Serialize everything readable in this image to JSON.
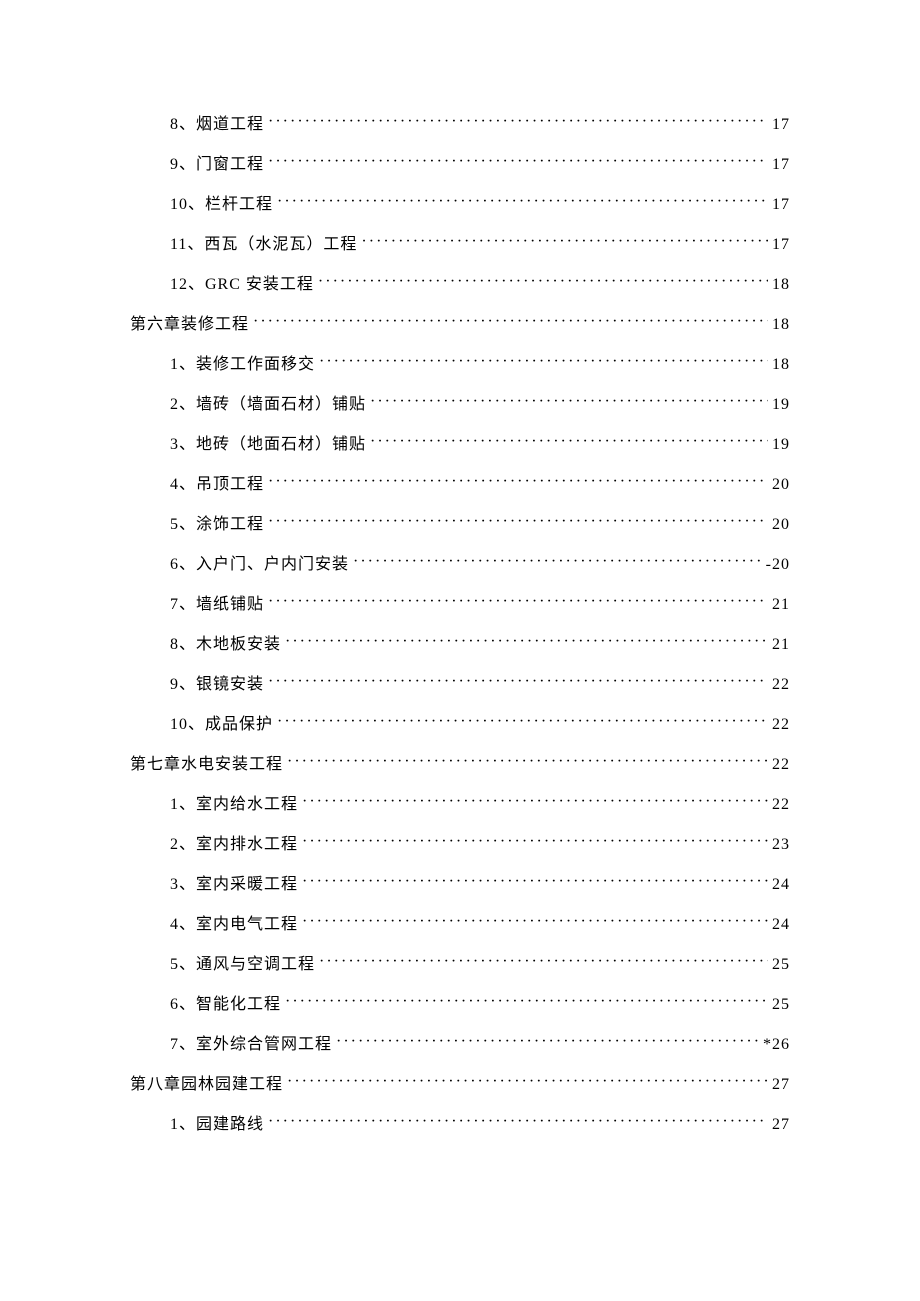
{
  "toc": [
    {
      "level": 2,
      "label": "8、烟道工程",
      "page": "17",
      "prefix": ""
    },
    {
      "level": 2,
      "label": "9、门窗工程",
      "page": "17",
      "prefix": ""
    },
    {
      "level": 2,
      "label": "10、栏杆工程",
      "page": "17",
      "prefix": ""
    },
    {
      "level": 2,
      "label": "11、西瓦（水泥瓦）工程",
      "page": "17",
      "prefix": ""
    },
    {
      "level": 2,
      "label": "12、GRC 安装工程",
      "page": "18",
      "prefix": ""
    },
    {
      "level": 1,
      "label": "第六章装修工程",
      "page": "18",
      "prefix": ""
    },
    {
      "level": 2,
      "label": "1、装修工作面移交",
      "page": "18",
      "prefix": ""
    },
    {
      "level": 2,
      "label": "2、墙砖（墙面石材）铺贴",
      "page": "19",
      "prefix": ""
    },
    {
      "level": 2,
      "label": "3、地砖（地面石材）铺贴",
      "page": "19",
      "prefix": ""
    },
    {
      "level": 2,
      "label": "4、吊顶工程",
      "page": "20",
      "prefix": ""
    },
    {
      "level": 2,
      "label": "5、涂饰工程",
      "page": "20",
      "prefix": ""
    },
    {
      "level": 2,
      "label": "6、入户门、户内门安装",
      "page": "-20",
      "prefix": ""
    },
    {
      "level": 2,
      "label": "7、墙纸铺贴",
      "page": "21",
      "prefix": ""
    },
    {
      "level": 2,
      "label": "8、木地板安装",
      "page": "21",
      "prefix": ""
    },
    {
      "level": 2,
      "label": "9、银镜安装",
      "page": "22",
      "prefix": ""
    },
    {
      "level": 2,
      "label": "10、成品保护",
      "page": "22",
      "prefix": ""
    },
    {
      "level": 1,
      "label": "第七章水电安装工程",
      "page": "22",
      "prefix": ""
    },
    {
      "level": 2,
      "label": "1、室内给水工程",
      "page": "22",
      "prefix": ""
    },
    {
      "level": 2,
      "label": "2、室内排水工程",
      "page": "23",
      "prefix": ""
    },
    {
      "level": 2,
      "label": "3、室内采暖工程",
      "page": "24",
      "prefix": ""
    },
    {
      "level": 2,
      "label": "4、室内电气工程",
      "page": "24",
      "prefix": ""
    },
    {
      "level": 2,
      "label": "5、通风与空调工程",
      "page": "25",
      "prefix": ""
    },
    {
      "level": 2,
      "label": "6、智能化工程",
      "page": "25",
      "prefix": ""
    },
    {
      "level": 2,
      "label": "7、室外综合管网工程",
      "page": "*26",
      "prefix": ""
    },
    {
      "level": 1,
      "label": "第八章园林园建工程",
      "page": "27",
      "prefix": ""
    },
    {
      "level": 2,
      "label": "1、园建路线",
      "page": "27",
      "prefix": ""
    }
  ]
}
